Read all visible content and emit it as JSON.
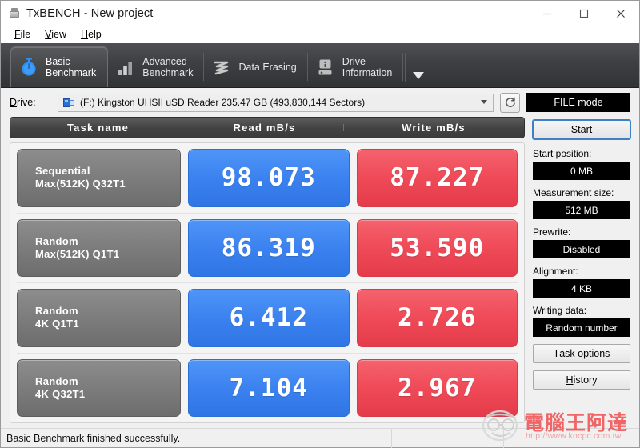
{
  "window": {
    "title": "TxBENCH - New project",
    "app_icon": "drive-icon",
    "controls": {
      "minimize": "minimize-icon",
      "maximize": "maximize-icon",
      "close": "close-icon"
    }
  },
  "menubar": {
    "items": [
      {
        "label": "File",
        "mnemonic": "F",
        "rest": "ile"
      },
      {
        "label": "View",
        "mnemonic": "V",
        "rest": "iew"
      },
      {
        "label": "Help",
        "mnemonic": "H",
        "rest": "elp"
      }
    ]
  },
  "tabs": {
    "items": [
      {
        "label": "Basic\nBenchmark",
        "icon": "stopwatch-icon",
        "active": true
      },
      {
        "label": "Advanced\nBenchmark",
        "icon": "bar-chart-icon",
        "active": false
      },
      {
        "label": "Data Erasing",
        "icon": "eraser-icon",
        "active": false
      },
      {
        "label": "Drive\nInformation",
        "icon": "drive-info-icon",
        "active": false
      }
    ],
    "overflow_icon": "chevron-down-icon"
  },
  "drive_bar": {
    "label": "Drive:",
    "selected": "(F:) Kingston UHSII uSD Reader  235.47 GB (493,830,144 Sectors)",
    "device_icon": "usb-drive-icon",
    "refresh_icon": "refresh-icon",
    "mode_button": "FILE mode"
  },
  "results": {
    "columns": [
      "Task name",
      "Read mB/s",
      "Write mB/s"
    ],
    "rows": [
      {
        "task_line1": "Sequential",
        "task_line2": "Max(512K) Q32T1",
        "read": "98.073",
        "write": "87.227"
      },
      {
        "task_line1": "Random",
        "task_line2": "Max(512K) Q1T1",
        "read": "86.319",
        "write": "53.590"
      },
      {
        "task_line1": "Random",
        "task_line2": "4K Q1T1",
        "read": "6.412",
        "write": "2.726"
      },
      {
        "task_line1": "Random",
        "task_line2": "4K Q32T1",
        "read": "7.104",
        "write": "2.967"
      }
    ]
  },
  "sidebar": {
    "start_button": {
      "label": "Start",
      "mnemonic": "S",
      "rest": "tart"
    },
    "fields": [
      {
        "label": "Start position:",
        "value": "0 MB"
      },
      {
        "label": "Measurement size:",
        "value": "512 MB"
      },
      {
        "label": "Prewrite:",
        "value": "Disabled"
      },
      {
        "label": "Alignment:",
        "value": "4 KB"
      },
      {
        "label": "Writing data:",
        "value": "Random number"
      }
    ],
    "task_options_button": {
      "label": "Task options",
      "mnemonic": "T",
      "rest": "ask options"
    },
    "history_button": {
      "label": "History",
      "mnemonic": "H",
      "rest": "istory"
    }
  },
  "statusbar": {
    "message": "Basic Benchmark finished successfully."
  },
  "watermark": {
    "text": "電腦王阿達",
    "url": "http://www.kocpc.com.tw"
  },
  "colors": {
    "read_accent": "#3b82f0",
    "write_accent": "#ef4a57",
    "tab_active": "#4a4b4d",
    "tabstrip": "#3d3f42",
    "value_field_bg": "#000000",
    "focus_ring": "#3f7fc4"
  }
}
